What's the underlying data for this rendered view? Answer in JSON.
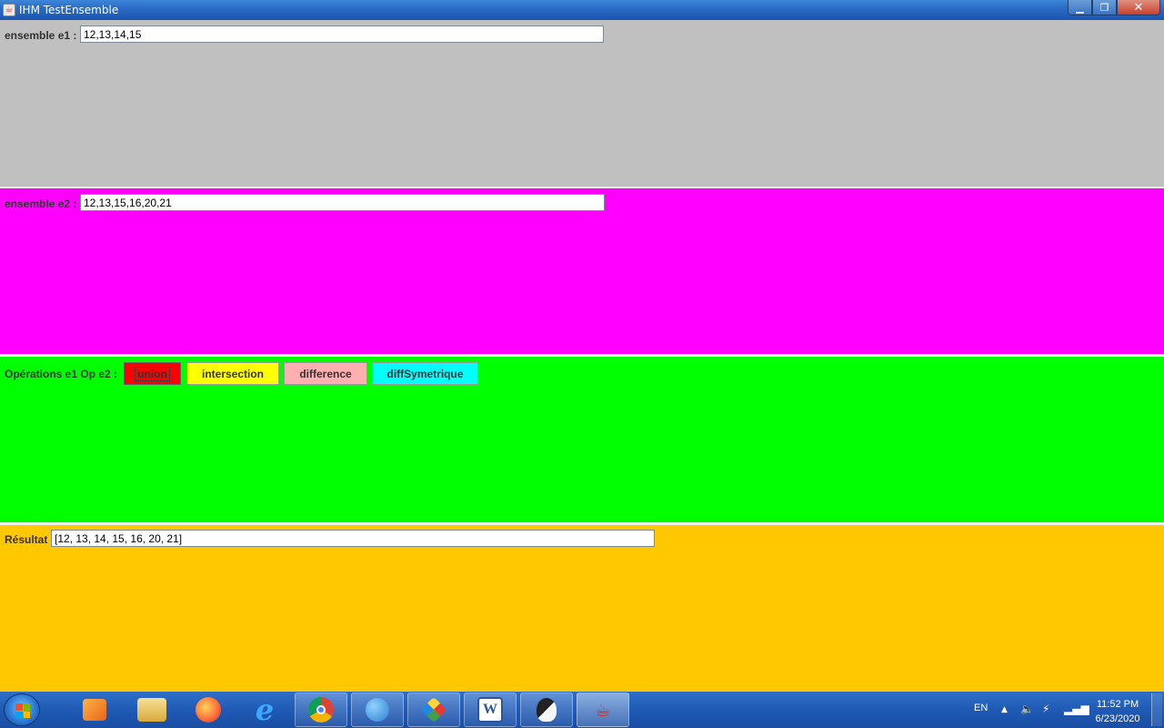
{
  "window": {
    "title": "IHM TestEnsemble",
    "app_icon": "java-icon",
    "controls": {
      "minimize": "▁",
      "maximize": "❐",
      "close": "✕"
    }
  },
  "panel_e1": {
    "label": "ensemble e1 :",
    "value": "12,13,14,15",
    "background": "#c0c0c0"
  },
  "panel_e2": {
    "label": "ensemble e2 :",
    "value": "12,13,15,16,20,21",
    "background": "#ff00ff"
  },
  "panel_ops": {
    "label": "Opérations e1 Op e2  :",
    "background": "#00ff00",
    "buttons": {
      "union": "union",
      "intersection": "intersection",
      "difference": "difference",
      "diffSymetrique": "diffSymetrique"
    },
    "button_colors": {
      "union": "#ff0000",
      "intersection": "#ffff00",
      "difference": "#ffafaf",
      "diffSymetrique": "#00ffff"
    }
  },
  "panel_result": {
    "label": "Résultat",
    "value": "[12, 13, 14, 15, 16, 20, 21]",
    "background": "#ffc800"
  },
  "taskbar": {
    "items": [
      "media-player-icon",
      "file-explorer-icon",
      "firefox-icon",
      "internet-explorer-icon",
      "chrome-icon",
      "users-icon",
      "tool-icon",
      "word-icon",
      "penguin-icon",
      "java-icon"
    ],
    "tray": {
      "language": "EN",
      "time": "11:52 PM",
      "date": "6/23/2020"
    }
  }
}
